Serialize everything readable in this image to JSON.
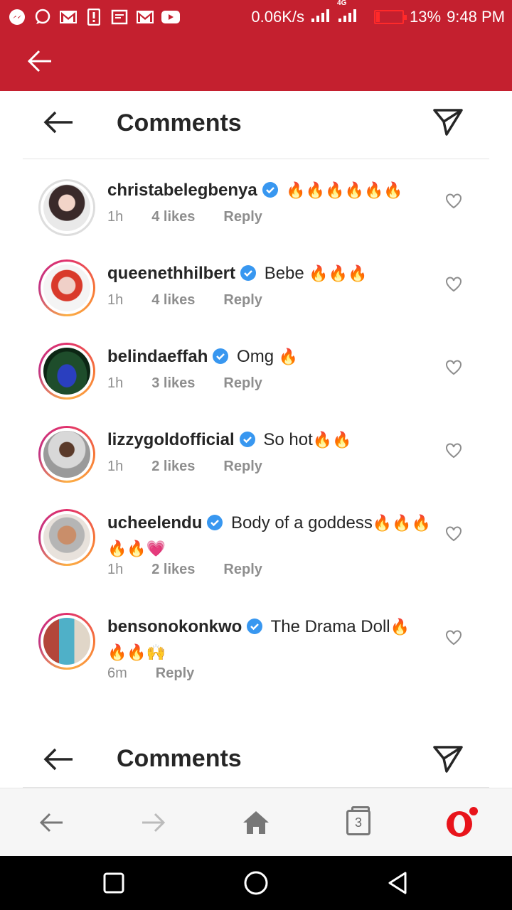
{
  "status_bar": {
    "network_speed": "0.06K/s",
    "network_type": "4G",
    "battery": "13%",
    "time": "9:48 PM",
    "notification_icons": [
      "messenger-icon",
      "chat-bubble-icon",
      "gmail-icon",
      "alert-icon",
      "cast-icon",
      "gmail-icon",
      "youtube-icon"
    ]
  },
  "opera_header": {
    "back_icon": "arrow-left-icon"
  },
  "comments_header": {
    "title": "Comments"
  },
  "comments": [
    {
      "username": "christabelegbenya",
      "verified": true,
      "text": "",
      "emoji": "🔥🔥🔥🔥🔥🔥",
      "time": "1h",
      "likes": "4 likes",
      "reply": "Reply",
      "ring": false
    },
    {
      "username": "queenethhilbert",
      "verified": true,
      "text": "Bebe",
      "emoji": "🔥🔥🔥",
      "time": "1h",
      "likes": "4 likes",
      "reply": "Reply",
      "ring": true
    },
    {
      "username": "belindaeffah",
      "verified": true,
      "text": "Omg",
      "emoji": "🔥",
      "time": "1h",
      "likes": "3 likes",
      "reply": "Reply",
      "ring": true
    },
    {
      "username": "lizzygoldofficial",
      "verified": true,
      "text": "So hot",
      "emoji": "🔥🔥",
      "time": "1h",
      "likes": "2 likes",
      "reply": "Reply",
      "ring": true
    },
    {
      "username": "ucheelendu",
      "verified": true,
      "text": "Body of a goddess",
      "emoji": "🔥🔥🔥🔥🔥💗",
      "time": "1h",
      "likes": "2 likes",
      "reply": "Reply",
      "ring": true
    },
    {
      "username": "bensonokonkwo",
      "verified": true,
      "text": "The Drama Doll",
      "emoji": "🔥🔥🔥🙌",
      "time": "6m",
      "likes": "",
      "reply": "Reply",
      "ring": true
    }
  ],
  "comments_header_2": {
    "title": "Comments"
  },
  "opera_nav": {
    "tabs_count": "3"
  },
  "colors": {
    "opera_red": "#c4202f",
    "verified_blue": "#3897f0",
    "meta_gray": "#8e8e8e"
  }
}
